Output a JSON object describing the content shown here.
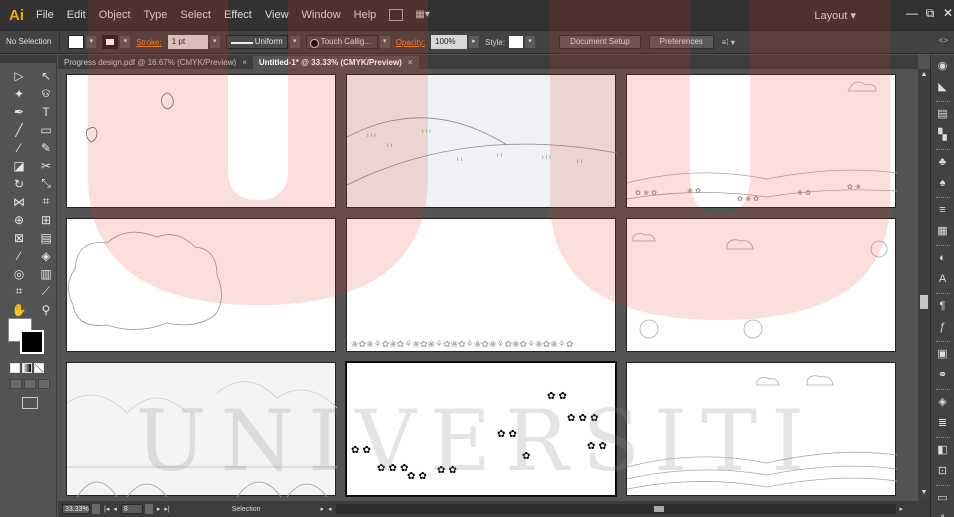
{
  "app": {
    "logo": "Ai",
    "menus": [
      "File",
      "Edit",
      "Object",
      "Type",
      "Select",
      "Effect",
      "View",
      "Window",
      "Help"
    ],
    "workspace": "Layout",
    "window_buttons": {
      "minimize": "—",
      "restore": "⧉",
      "close": "✕"
    }
  },
  "control_bar": {
    "selection": "No Selection",
    "stroke_label": "Stroke:",
    "stroke_weight": "1 pt",
    "stroke_profile": "Uniform",
    "brush": "Touch Callig...",
    "opacity_label": "Opacity:",
    "opacity_value": "100%",
    "style_label": "Style:",
    "document_setup": "Document Setup",
    "preferences": "Preferences",
    "right_icon": "<>"
  },
  "tabs": [
    {
      "label": "Progress design.pdf @ 16.67% (CMYK/Preview)",
      "close": "×",
      "active": false
    },
    {
      "label": "Untitled-1* @ 33.33% (CMYK/Preview)",
      "close": "×",
      "active": true
    }
  ],
  "tools": [
    {
      "icon": "selection-arrow-icon",
      "glyph": "▷"
    },
    {
      "icon": "direct-selection-icon",
      "glyph": "↖"
    },
    {
      "icon": "magic-wand-icon",
      "glyph": "✦"
    },
    {
      "icon": "lasso-icon",
      "glyph": "ଡ"
    },
    {
      "icon": "pen-icon",
      "glyph": "✒"
    },
    {
      "icon": "type-icon",
      "glyph": "T"
    },
    {
      "icon": "line-icon",
      "glyph": "╱"
    },
    {
      "icon": "rectangle-icon",
      "glyph": "▭"
    },
    {
      "icon": "paintbrush-icon",
      "glyph": "⁄"
    },
    {
      "icon": "pencil-icon",
      "glyph": "✎"
    },
    {
      "icon": "eraser-icon",
      "glyph": "◪"
    },
    {
      "icon": "scissors-icon",
      "glyph": "✂"
    },
    {
      "icon": "rotate-icon",
      "glyph": "↻"
    },
    {
      "icon": "scale-icon",
      "glyph": "⤡"
    },
    {
      "icon": "width-icon",
      "glyph": "⋈"
    },
    {
      "icon": "free-transform-icon",
      "glyph": "⌗"
    },
    {
      "icon": "shape-builder-icon",
      "glyph": "⊕"
    },
    {
      "icon": "perspective-icon",
      "glyph": "⊞"
    },
    {
      "icon": "mesh-icon",
      "glyph": "⊠"
    },
    {
      "icon": "gradient-icon",
      "glyph": "▤"
    },
    {
      "icon": "eyedropper-icon",
      "glyph": "⁄"
    },
    {
      "icon": "blend-icon",
      "glyph": "◈"
    },
    {
      "icon": "symbol-sprayer-icon",
      "glyph": "◎"
    },
    {
      "icon": "column-graph-icon",
      "glyph": "▥"
    },
    {
      "icon": "artboard-icon",
      "glyph": "⌗"
    },
    {
      "icon": "slice-icon",
      "glyph": "⟋"
    },
    {
      "icon": "hand-icon",
      "glyph": "✋"
    },
    {
      "icon": "zoom-icon",
      "glyph": "⚲"
    }
  ],
  "right_panel_icons": [
    "color-icon",
    "color-guide-icon",
    "swatches-icon",
    "brushes-icon",
    "symbols-icon",
    "graphic-styles-icon",
    "stroke-icon",
    "gradient-icon",
    "transparency-icon",
    "character-icon",
    "paragraph-icon",
    "opentype-icon",
    "layers-icon",
    "links-icon",
    "appearance-icon",
    "align-icon",
    "pathfinder-icon",
    "transform-icon",
    "artboards-icon",
    "type-icon"
  ],
  "status_bar": {
    "zoom": "33.33%",
    "page": "8",
    "tool": "Selection"
  },
  "colors": {
    "app_bg": "#535353",
    "menubar": "#323232",
    "logo": "#f7a400",
    "stroke_link": "#f28c28",
    "watermark_red": "#e8362b"
  },
  "watermark_text": "UNIVERSITI"
}
